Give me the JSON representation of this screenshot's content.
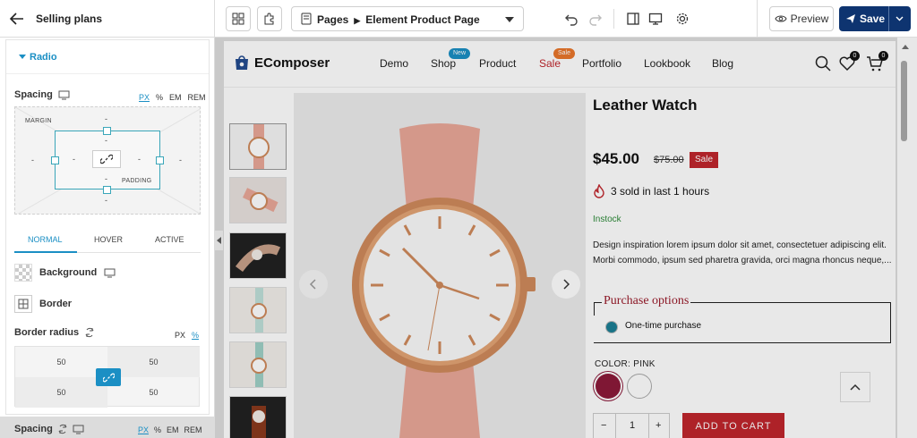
{
  "topbar": {
    "title": "Selling plans",
    "page_path": [
      "Pages",
      "Element Product Page"
    ],
    "preview_label": "Preview",
    "save_label": "Save"
  },
  "panel": {
    "section_title": "Radio",
    "spacing_label": "Spacing",
    "units": [
      "PX",
      "%",
      "EM",
      "REM"
    ],
    "active_unit": "PX",
    "margin_label": "MARGIN",
    "padding_label": "PADDING",
    "empty_value": "-",
    "tabs": [
      "NORMAL",
      "HOVER",
      "ACTIVE"
    ],
    "active_tab": "NORMAL",
    "background_label": "Background",
    "border_label": "Border",
    "border_radius_label": "Border radius",
    "radius_units": [
      "PX",
      "%"
    ],
    "radius_values": [
      "50",
      "50",
      "50",
      "50"
    ],
    "bottom_spacing_label": "Spacing",
    "bottom_units": [
      "PX",
      "%",
      "EM",
      "REM"
    ]
  },
  "site": {
    "logo_text": "EComposer",
    "nav": [
      {
        "label": "Demo"
      },
      {
        "label": "Shop",
        "badge": "New",
        "badge_color": "#1b8fc4"
      },
      {
        "label": "Product"
      },
      {
        "label": "Sale",
        "badge": "Sale",
        "badge_color": "#e9762b",
        "accent": "#c0262d"
      },
      {
        "label": "Portfolio"
      },
      {
        "label": "Lookbook"
      },
      {
        "label": "Blog"
      }
    ],
    "wishlist_count": "0",
    "cart_count": "0"
  },
  "product": {
    "title": "Leather Watch",
    "price": "$45.00",
    "compare_price": "$75.00",
    "sale_badge": "Sale",
    "sold_text": "3 sold in last 1 hours",
    "stock": "Instock",
    "description": "Design inspiration lorem ipsum dolor sit amet, consectetuer adipiscing elit. Morbi commodo, ipsum sed pharetra gravida, orci magna rhoncus neque,...",
    "purchase_options_label": "Purchase options",
    "purchase_option": "One-time purchase",
    "color_label": "COLOR: PINK",
    "swatches": [
      "#8c1a3a",
      "#ffffff"
    ],
    "qty": "1",
    "qty_minus": "−",
    "qty_plus": "+",
    "add_to_cart": "ADD TO CART"
  },
  "colors": {
    "accent": "#1b8fc4",
    "save_bg": "#0e3470",
    "sale_red": "#c0262d",
    "strap": "#e9a898",
    "case": "#cf8a5c"
  }
}
